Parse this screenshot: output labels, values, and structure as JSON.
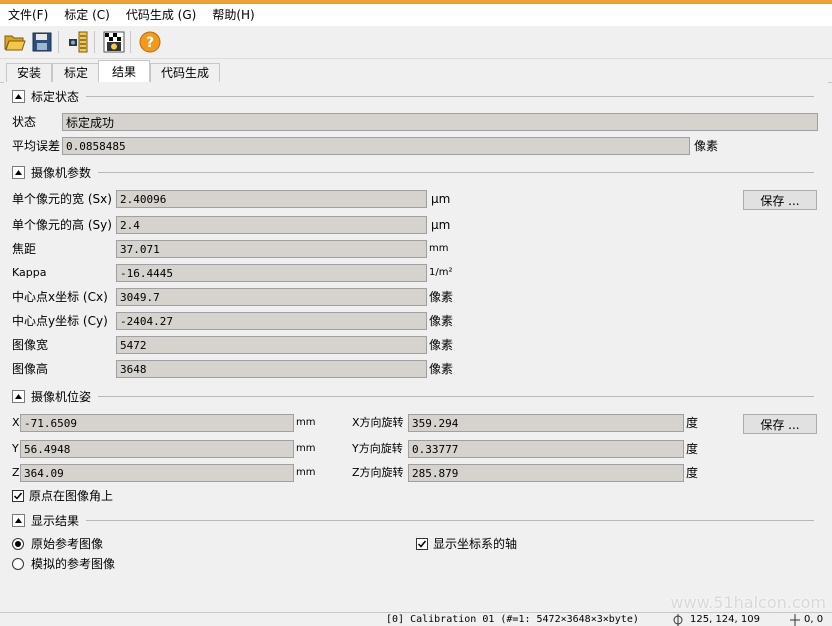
{
  "menu": [
    "文件(F)",
    "标定 (C)",
    "代码生成 (G)",
    "帮助(H)"
  ],
  "tabs": [
    "安装",
    "标定",
    "结果",
    "代码生成"
  ],
  "calib_status": {
    "title": "标定状态",
    "status_label": "状态",
    "status_value": "标定成功",
    "error_label": "平均误差",
    "error_value": "0.0858485",
    "error_unit": "像素"
  },
  "camera_params": {
    "title": "摄像机参数",
    "save": "保存 ...",
    "rows": [
      {
        "label": "单个像元的宽 (Sx)",
        "value": "2.40096",
        "unit": "μm"
      },
      {
        "label": "单个像元的高 (Sy)",
        "value": "2.4",
        "unit": "μm"
      },
      {
        "label": "焦距",
        "value": "37.071",
        "unit": "mm"
      },
      {
        "label": "Kappa",
        "value": "-16.4445",
        "unit": "1/m²"
      },
      {
        "label": "中心点x坐标 (Cx)",
        "value": "3049.7",
        "unit": "像素"
      },
      {
        "label": "中心点y坐标 (Cy)",
        "value": "-2404.27",
        "unit": "像素"
      },
      {
        "label": "图像宽",
        "value": "5472",
        "unit": "像素"
      },
      {
        "label": "图像高",
        "value": "3648",
        "unit": "像素"
      }
    ]
  },
  "camera_pose": {
    "title": "摄像机位姿",
    "save": "保存 ...",
    "rows": [
      {
        "label": "X",
        "value": "-71.6509",
        "unit": "mm",
        "rot_label": "X方向旋转",
        "rot_value": "359.294",
        "rot_unit": "度"
      },
      {
        "label": "Y",
        "value": "56.4948",
        "unit": "mm",
        "rot_label": "Y方向旋转",
        "rot_value": "0.33777",
        "rot_unit": "度"
      },
      {
        "label": "Z",
        "value": "364.09",
        "unit": "mm",
        "rot_label": "Z方向旋转",
        "rot_value": "285.879",
        "rot_unit": "度"
      }
    ],
    "origin_label": "原点在图像角上"
  },
  "display": {
    "title": "显示结果",
    "radio1": "原始参考图像",
    "radio2": "模拟的参考图像",
    "axis_label": "显示坐标系的轴"
  },
  "status_bar": {
    "text1": "[0] Calibration 01 (#=1: 5472×3648×3×byte)",
    "text2": "125, 124, 109",
    "text3": "0, 0"
  },
  "watermark": "www.51halcon.com",
  "colors": {
    "accent": "#f0a030",
    "field_bg": "#d6d3ce"
  }
}
